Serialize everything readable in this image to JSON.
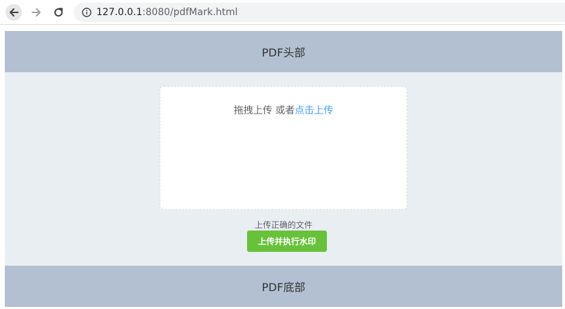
{
  "browser": {
    "url_host": "127.0.0.1",
    "url_rest": ":8080/pdfMark.html",
    "icons": {
      "back": "arrow-left-icon",
      "forward": "arrow-right-icon",
      "reload": "reload-icon",
      "info": "info-icon"
    }
  },
  "page": {
    "header_title": "PDF头部",
    "footer_title": "PDF底部"
  },
  "upload": {
    "drag_text": "拖拽上传 或者",
    "click_text": "点击上传",
    "tip": "上传正确的文件",
    "submit_label": "上传并执行水印"
  },
  "colors": {
    "header_bg": "#b3c0d1",
    "main_bg": "#e9eef3",
    "link": "#409eff",
    "success": "#67c23a"
  }
}
